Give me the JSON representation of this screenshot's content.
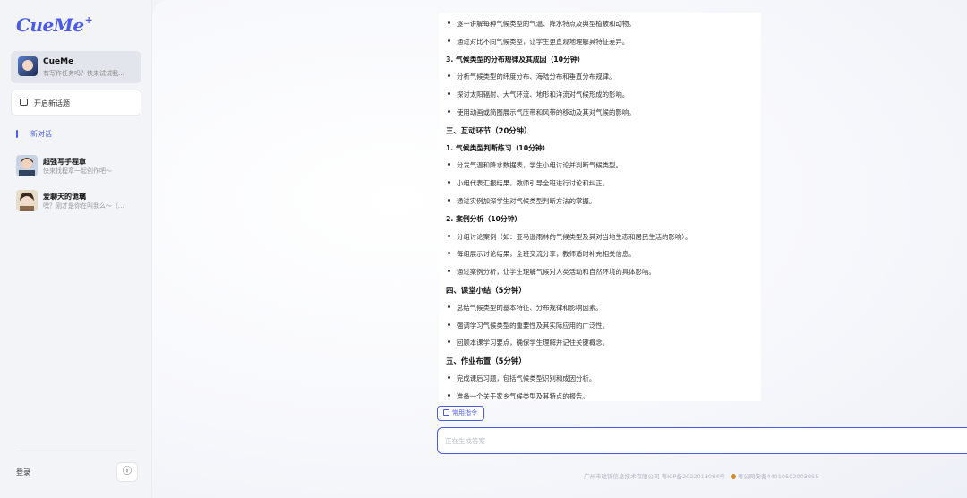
{
  "sidebar": {
    "logo": "CueMe",
    "logo_spark": "+",
    "bot": {
      "name": "CueMe",
      "desc": "有写作任务吗？快来试试我..."
    },
    "new_topic": "开启新话题",
    "new_chat": "新对话",
    "chats": [
      {
        "title": "超强写手程章",
        "subtitle": "快来找程章一起创作吧～"
      },
      {
        "title": "爱聊天的诡璃",
        "subtitle": "嘿？刚才是你在叫我么～（..."
      }
    ],
    "login": "登录",
    "info_icon": "ⓘ"
  },
  "content": {
    "lines": [
      {
        "kind": "bullet",
        "text": "逐一讲解每种气候类型的气温、降水特点及典型植被和动物。"
      },
      {
        "kind": "bullet",
        "text": "通过对比不同气候类型，让学生更直观地理解其特征差异。"
      },
      {
        "kind": "h3",
        "text": "3. 气候类型的分布规律及其成因（10分钟）"
      },
      {
        "kind": "bullet",
        "text": "分析气候类型的纬度分布、海陆分布和垂直分布规律。"
      },
      {
        "kind": "bullet",
        "text": "探讨太阳辐射、大气环流、地形和洋流对气候形成的影响。"
      },
      {
        "kind": "bullet",
        "text": "使用动画或简图展示气压带和风带的移动及其对气候的影响。"
      },
      {
        "kind": "h2",
        "text": "三、互动环节（20分钟）"
      },
      {
        "kind": "h3",
        "text": "1. 气候类型判断练习（10分钟）"
      },
      {
        "kind": "bullet",
        "text": "分发气温和降水数据表，学生小组讨论并判断气候类型。"
      },
      {
        "kind": "bullet",
        "text": "小组代表汇报结果，教师引导全班进行讨论和纠正。"
      },
      {
        "kind": "bullet",
        "text": "通过实例加深学生对气候类型判断方法的掌握。"
      },
      {
        "kind": "h3",
        "text": "2. 案例分析（10分钟）"
      },
      {
        "kind": "bullet",
        "text": "分组讨论案例（如：亚马逊雨林的气候类型及其对当地生态和居民生活的影响）。"
      },
      {
        "kind": "bullet",
        "text": "每组展示讨论结果，全班交流分享，教师适时补充相关信息。"
      },
      {
        "kind": "bullet",
        "text": "通过案例分析，让学生理解气候对人类活动和自然环境的具体影响。"
      },
      {
        "kind": "h2",
        "text": "四、课堂小结（5分钟）"
      },
      {
        "kind": "bullet",
        "text": "总结气候类型的基本特征、分布规律和影响因素。"
      },
      {
        "kind": "bullet",
        "text": "强调学习气候类型的重要性及其实际应用的广泛性。"
      },
      {
        "kind": "bullet",
        "text": "回顾本课学习要点，确保学生理解并记住关键概念。"
      },
      {
        "kind": "h2",
        "text": "五、作业布置（5分钟）"
      },
      {
        "kind": "bullet",
        "text": "完成课后习题，包括气候类型识别和成因分析。"
      },
      {
        "kind": "bullet",
        "text": "准备一个关于家乡气候类型及其特点的报告。"
      }
    ]
  },
  "composer": {
    "common_cmd": "常用指令",
    "placeholder": "正在生成答案"
  },
  "footer": {
    "company": "广州市珑锦信息技术有限公司",
    "icp": "粤ICP备2022013084号",
    "police": "粤公网安备44010502003055"
  },
  "colors": {
    "accent": "#4b5be6"
  }
}
